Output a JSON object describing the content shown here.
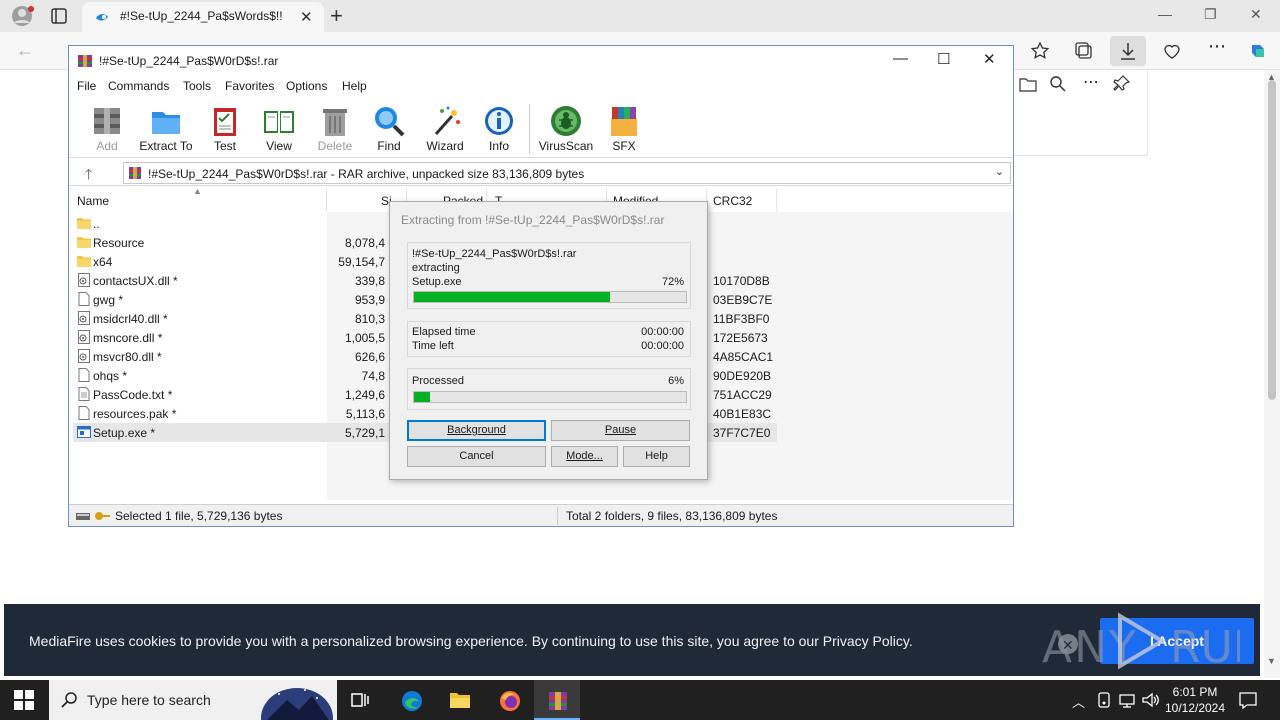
{
  "browser": {
    "tab_title": "#!Se-tUp_2244_Pa$sWords$!!",
    "colors": {
      "tabstrip": "#e8e8e8",
      "accent": "#0078d7"
    }
  },
  "winrar": {
    "title": "!#Se-tUp_2244_Pas$W0rD$s!.rar",
    "menu": [
      "File",
      "Commands",
      "Tools",
      "Favorites",
      "Options",
      "Help"
    ],
    "toolbar": [
      {
        "label": "Add",
        "icon": "add-archive-icon",
        "enabled": false
      },
      {
        "label": "Extract To",
        "icon": "extract-folder-icon",
        "enabled": true
      },
      {
        "label": "Test",
        "icon": "test-clipboard-icon",
        "enabled": true
      },
      {
        "label": "View",
        "icon": "view-book-icon",
        "enabled": true
      },
      {
        "label": "Delete",
        "icon": "trash-icon",
        "enabled": false
      },
      {
        "label": "Find",
        "icon": "magnifier-icon",
        "enabled": true
      },
      {
        "label": "Wizard",
        "icon": "wizard-wand-icon",
        "enabled": true
      },
      {
        "label": "Info",
        "icon": "info-icon",
        "enabled": true
      },
      {
        "label": "VirusScan",
        "icon": "virus-scan-icon",
        "enabled": true
      },
      {
        "label": "SFX",
        "icon": "sfx-books-icon",
        "enabled": true
      }
    ],
    "address": "!#Se-tUp_2244_Pas$W0rD$s!.rar - RAR archive, unpacked size 83,136,809 bytes",
    "columns": {
      "name": "Name",
      "size": "Si",
      "packed": "Packed",
      "type": "T",
      "modified": "Modified",
      "crc": "CRC32"
    },
    "files": [
      {
        "name": "..",
        "type": "folder",
        "size": "",
        "crc": ""
      },
      {
        "name": "Resource",
        "type": "folder",
        "size": "8,078,4",
        "crc": ""
      },
      {
        "name": "x64",
        "type": "folder",
        "size": "59,154,7",
        "crc": ""
      },
      {
        "name": "contactsUX.dll *",
        "type": "dll",
        "size": "339,8",
        "crc": "10170D8B"
      },
      {
        "name": "gwg *",
        "type": "file",
        "size": "953,9",
        "crc": "03EB9C7E"
      },
      {
        "name": "msidcrl40.dll *",
        "type": "dll",
        "size": "810,3",
        "crc": "11BF3BF0"
      },
      {
        "name": "msncore.dll *",
        "type": "dll",
        "size": "1,005,5",
        "crc": "172E5673"
      },
      {
        "name": "msvcr80.dll *",
        "type": "dll",
        "size": "626,6",
        "crc": "4A85CAC1"
      },
      {
        "name": "ohqs *",
        "type": "file",
        "size": "74,8",
        "crc": "90DE920B"
      },
      {
        "name": "PassCode.txt *",
        "type": "txt",
        "size": "1,249,6",
        "crc": "751ACC29"
      },
      {
        "name": "resources.pak *",
        "type": "file",
        "size": "5,113,6",
        "crc": "40B1E83C"
      },
      {
        "name": "Setup.exe *",
        "type": "exe",
        "size": "5,729,1",
        "crc": "37F7C7E0",
        "selected": true
      }
    ],
    "status_left": "Selected 1 file, 5,729,136 bytes",
    "status_right": "Total 2 folders, 9 files, 83,136,809 bytes"
  },
  "extract_dialog": {
    "title": "Extracting from !#Se-tUp_2244_Pas$W0rD$s!.rar",
    "archive": "!#Se-tUp_2244_Pas$W0rD$s!.rar",
    "action": "extracting",
    "current_file": "Setup.exe",
    "file_percent_text": "72%",
    "file_progress": 0.72,
    "elapsed_label": "Elapsed time",
    "elapsed_value": "00:00:00",
    "left_label": "Time left",
    "left_value": "00:00:00",
    "processed_label": "Processed",
    "processed_percent_text": "6%",
    "processed_progress": 0.06,
    "buttons": {
      "background": "Background",
      "pause": "Pause",
      "cancel": "Cancel",
      "mode": "Mode...",
      "help": "Help"
    }
  },
  "cookie_banner": {
    "text": "MediaFire uses cookies to provide you with a personalized browsing experience. By continuing to use this site, you agree to our Privacy Policy.",
    "accept": "I Accept",
    "watermark": "ANY RUN"
  },
  "taskbar": {
    "search_placeholder": "Type here to search",
    "time": "6:01 PM",
    "date": "10/12/2024"
  }
}
